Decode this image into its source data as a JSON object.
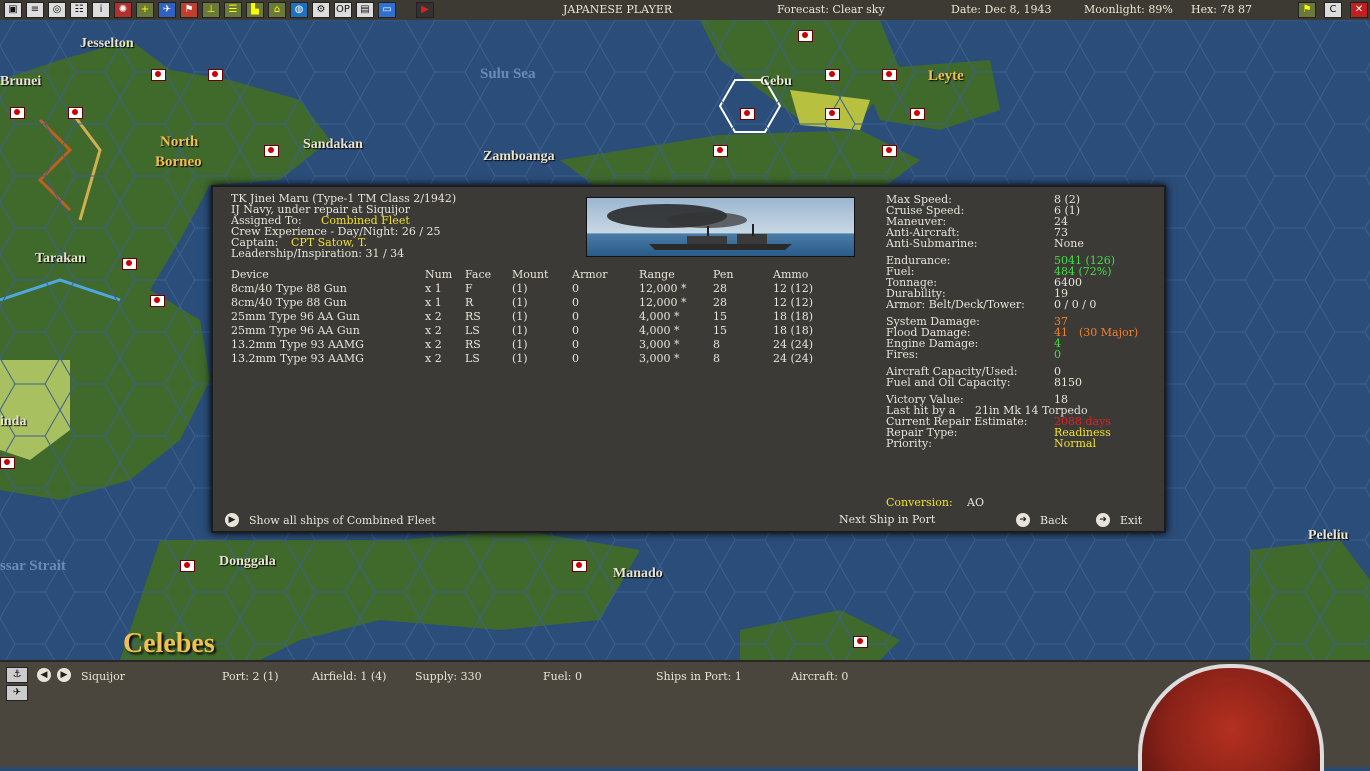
{
  "topbar": {
    "player": "JAPANESE PLAYER",
    "forecast": "Forecast: Clear sky",
    "date": "Date: Dec 8, 1943",
    "moonlight": "Moonlight: 89%",
    "hex": "Hex: 78 87",
    "icons": [
      "map-icon",
      "report-icon",
      "intel-icon",
      "group-icon",
      "info-icon",
      "japan-flag-icon",
      "medical-icon",
      "air-icon",
      "flag-icon",
      "airfield-icon",
      "hq-icon",
      "base-icon",
      "list-icon",
      "globe-icon",
      "settings-icon",
      "op-icon",
      "tf-icon",
      "save-icon",
      "end-turn-icon"
    ]
  },
  "places": {
    "jesselton": "Jesselton",
    "brunei": "Brunei",
    "sulu_sea": "Sulu Sea",
    "cebu": "Cebu",
    "leyte": "Leyte",
    "north_borneo_1": "North",
    "north_borneo_2": "Borneo",
    "sandakan": "Sandakan",
    "zamboanga": "Zamboanga",
    "tarakan": "Tarakan",
    "inda": "inda",
    "donggala": "Donggala",
    "manado": "Manado",
    "celebes": "Celebes",
    "peleliu": "Peleliu",
    "makassar": "ssar Strait"
  },
  "ship": {
    "name": "TK Jinei Maru (Type-1 TM Class 2/1942)",
    "status": "IJ Navy, under repair at Siquijor",
    "assigned_label": "Assigned To:",
    "assigned_value": "Combined Fleet",
    "crew_exp": "Crew Experience - Day/Night: 26 / 25",
    "captain_label": "Captain:",
    "captain_value": "CPT Satow, T.",
    "leadership": "Leadership/Inspiration: 31 / 34"
  },
  "devices": {
    "headers": [
      "Device",
      "Num",
      "Face",
      "Mount",
      "Armor",
      "Range",
      "Pen",
      "Ammo"
    ],
    "rows": [
      [
        "8cm/40 Type 88 Gun",
        "x 1",
        "F",
        "(1)",
        "0",
        "12,000 *",
        "28",
        "12  (12)"
      ],
      [
        "8cm/40 Type 88 Gun",
        "x 1",
        "R",
        "(1)",
        "0",
        "12,000 *",
        "28",
        "12  (12)"
      ],
      [
        "25mm Type 96 AA Gun",
        "x 2",
        "RS",
        "(1)",
        "0",
        "4,000 *",
        "15",
        "18  (18)"
      ],
      [
        "25mm Type 96 AA Gun",
        "x 2",
        "LS",
        "(1)",
        "0",
        "4,000 *",
        "15",
        "18  (18)"
      ],
      [
        "13.2mm Type 93 AAMG",
        "x 2",
        "RS",
        "(1)",
        "0",
        "3,000 *",
        "8",
        "24  (24)"
      ],
      [
        "13.2mm Type 93 AAMG",
        "x 2",
        "LS",
        "(1)",
        "0",
        "3,000 *",
        "8",
        "24  (24)"
      ]
    ]
  },
  "stats": {
    "max_speed_l": "Max Speed:",
    "max_speed_v": "8 (2)",
    "cruise_l": "Cruise Speed:",
    "cruise_v": "6 (1)",
    "maneuver_l": "Maneuver:",
    "maneuver_v": "24",
    "aa_l": "Anti-Aircraft:",
    "aa_v": "73",
    "asw_l": "Anti-Submarine:",
    "asw_v": "None",
    "endurance_l": "Endurance:",
    "endurance_v": "5041 (126)",
    "fuel_l": "Fuel:",
    "fuel_v": "484 (72%)",
    "tonnage_l": "Tonnage:",
    "tonnage_v": "6400",
    "durability_l": "Durability:",
    "durability_v": "19",
    "armor_l": "Armor: Belt/Deck/Tower:",
    "armor_v": "0 / 0 / 0",
    "sys_l": "System Damage:",
    "sys_v": "37",
    "flood_l": "Flood Damage:",
    "flood_v": "41",
    "flood_major": "(30 Major)",
    "engine_l": "Engine Damage:",
    "engine_v": "4",
    "fires_l": "Fires:",
    "fires_v": "0",
    "aircraft_l": "Aircraft Capacity/Used:",
    "aircraft_v": "0",
    "fuel_oil_l": "Fuel and Oil Capacity:",
    "fuel_oil_v": "8150",
    "vv_l": "Victory Value:",
    "vv_v": "18",
    "lasthit_l": "Last hit by a",
    "lasthit_v": "21in Mk 14 Torpedo",
    "repair_est_l": "Current Repair Estimate:",
    "repair_est_v": "2088 days",
    "repair_type_l": "Repair Type:",
    "repair_type_v": "Readiness",
    "priority_l": "Priority:",
    "priority_v": "Normal",
    "conversion_l": "Conversion:",
    "conversion_v": "AO"
  },
  "actions": {
    "show_all": "Show all ships of Combined Fleet",
    "next_ship": "Next Ship in Port",
    "back": "Back",
    "exit": "Exit"
  },
  "bottombar": {
    "location": "Siquijor",
    "port": "Port: 2 (1)",
    "airfield": "Airfield: 1 (4)",
    "supply": "Supply: 330",
    "fuel": "Fuel: 0",
    "ships": "Ships in Port: 1",
    "aircraft": "Aircraft: 0"
  },
  "colors": {
    "ocean": "#2b4d7a",
    "land": "#3f6a2c",
    "panel": "#3b3a37",
    "highlight_yellow": "#f0e030",
    "good_green": "#40e040",
    "warn_orange": "#f08030",
    "bad_red": "#e02020"
  }
}
